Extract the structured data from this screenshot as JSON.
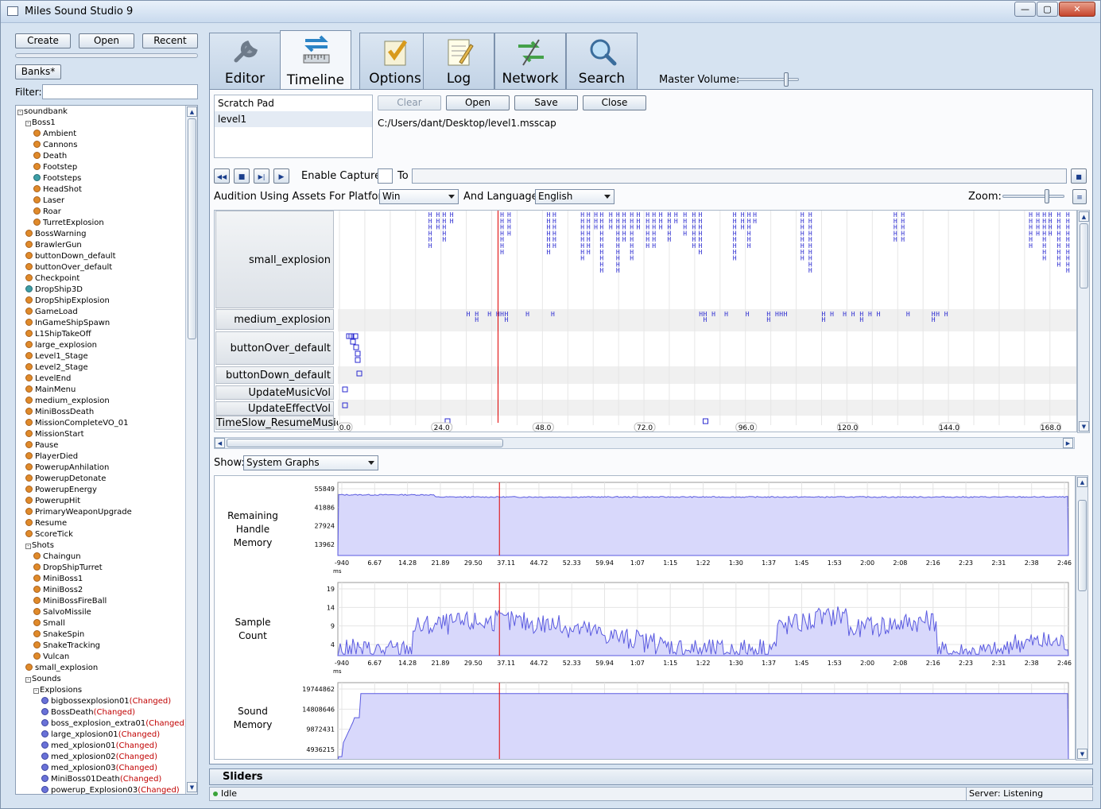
{
  "window": {
    "title": "Miles Sound Studio 9",
    "min": "—",
    "max": "▢",
    "close": "✕"
  },
  "left": {
    "create": "Create",
    "open": "Open",
    "recent": "Recent",
    "banks": "Banks*",
    "filter_label": "Filter:",
    "tree": [
      {
        "d": 0,
        "t": "soundbank",
        "exp": "-"
      },
      {
        "d": 1,
        "t": "Boss1",
        "exp": "-"
      },
      {
        "d": 2,
        "t": "Ambient",
        "icon": "orange"
      },
      {
        "d": 2,
        "t": "Cannons",
        "icon": "orange"
      },
      {
        "d": 2,
        "t": "Death",
        "icon": "orange"
      },
      {
        "d": 2,
        "t": "Footstep",
        "icon": "orange"
      },
      {
        "d": 2,
        "t": "Footsteps",
        "icon": "teal"
      },
      {
        "d": 2,
        "t": "HeadShot",
        "icon": "orange"
      },
      {
        "d": 2,
        "t": "Laser",
        "icon": "orange"
      },
      {
        "d": 2,
        "t": "Roar",
        "icon": "orange"
      },
      {
        "d": 2,
        "t": "TurretExplosion",
        "icon": "orange"
      },
      {
        "d": 1,
        "t": "BossWarning",
        "icon": "orange"
      },
      {
        "d": 1,
        "t": "BrawlerGun",
        "icon": "orange"
      },
      {
        "d": 1,
        "t": "buttonDown_default",
        "icon": "orange"
      },
      {
        "d": 1,
        "t": "buttonOver_default",
        "icon": "orange"
      },
      {
        "d": 1,
        "t": "Checkpoint",
        "icon": "orange"
      },
      {
        "d": 1,
        "t": "DropShip3D",
        "icon": "teal"
      },
      {
        "d": 1,
        "t": "DropShipExplosion",
        "icon": "orange"
      },
      {
        "d": 1,
        "t": "GameLoad",
        "icon": "orange"
      },
      {
        "d": 1,
        "t": "InGameShipSpawn",
        "icon": "orange"
      },
      {
        "d": 1,
        "t": "L1ShipTakeOff",
        "icon": "orange"
      },
      {
        "d": 1,
        "t": "large_explosion",
        "icon": "orange"
      },
      {
        "d": 1,
        "t": "Level1_Stage",
        "icon": "orange"
      },
      {
        "d": 1,
        "t": "Level2_Stage",
        "icon": "orange"
      },
      {
        "d": 1,
        "t": "LevelEnd",
        "icon": "orange"
      },
      {
        "d": 1,
        "t": "MainMenu",
        "icon": "orange"
      },
      {
        "d": 1,
        "t": "medium_explosion",
        "icon": "orange"
      },
      {
        "d": 1,
        "t": "MiniBossDeath",
        "icon": "orange"
      },
      {
        "d": 1,
        "t": "MissionCompleteVO_01",
        "icon": "orange"
      },
      {
        "d": 1,
        "t": "MissionStart",
        "icon": "orange"
      },
      {
        "d": 1,
        "t": "Pause",
        "icon": "orange"
      },
      {
        "d": 1,
        "t": "PlayerDied",
        "icon": "orange"
      },
      {
        "d": 1,
        "t": "PowerupAnhilation",
        "icon": "orange"
      },
      {
        "d": 1,
        "t": "PowerupDetonate",
        "icon": "orange"
      },
      {
        "d": 1,
        "t": "PowerupEnergy",
        "icon": "orange"
      },
      {
        "d": 1,
        "t": "PowerupHit",
        "icon": "orange"
      },
      {
        "d": 1,
        "t": "PrimaryWeaponUpgrade",
        "icon": "orange"
      },
      {
        "d": 1,
        "t": "Resume",
        "icon": "orange"
      },
      {
        "d": 1,
        "t": "ScoreTick",
        "icon": "orange"
      },
      {
        "d": 1,
        "t": "Shots",
        "exp": "-"
      },
      {
        "d": 2,
        "t": "Chaingun",
        "icon": "orange"
      },
      {
        "d": 2,
        "t": "DropShipTurret",
        "icon": "orange"
      },
      {
        "d": 2,
        "t": "MiniBoss1",
        "icon": "orange"
      },
      {
        "d": 2,
        "t": "MiniBoss2",
        "icon": "orange"
      },
      {
        "d": 2,
        "t": "MiniBossFireBall",
        "icon": "orange"
      },
      {
        "d": 2,
        "t": "SalvoMissile",
        "icon": "orange"
      },
      {
        "d": 2,
        "t": "Small",
        "icon": "orange"
      },
      {
        "d": 2,
        "t": "SnakeSpin",
        "icon": "orange"
      },
      {
        "d": 2,
        "t": "SnakeTracking",
        "icon": "orange"
      },
      {
        "d": 2,
        "t": "Vulcan",
        "icon": "orange"
      },
      {
        "d": 1,
        "t": "small_explosion",
        "icon": "orange"
      },
      {
        "d": 1,
        "t": "Sounds",
        "exp": "-"
      },
      {
        "d": 2,
        "t": "Explosions",
        "exp": "-"
      },
      {
        "d": 3,
        "t": "bigbossexplosion01",
        "icon": "blue",
        "chg": "(Changed)"
      },
      {
        "d": 3,
        "t": "BossDeath",
        "icon": "blue",
        "chg": "(Changed)"
      },
      {
        "d": 3,
        "t": "boss_explosion_extra01",
        "icon": "blue",
        "chg": "(Changed)"
      },
      {
        "d": 3,
        "t": "large_xplosion01",
        "icon": "blue",
        "chg": "(Changed)"
      },
      {
        "d": 3,
        "t": "med_xplosion01",
        "icon": "blue",
        "chg": "(Changed)"
      },
      {
        "d": 3,
        "t": "med_xplosion02",
        "icon": "blue",
        "chg": "(Changed)"
      },
      {
        "d": 3,
        "t": "med_xplosion03",
        "icon": "blue",
        "chg": "(Changed)"
      },
      {
        "d": 3,
        "t": "MiniBoss01Death",
        "icon": "blue",
        "chg": "(Changed)"
      },
      {
        "d": 3,
        "t": "powerup_Explosion03",
        "icon": "blue",
        "chg": "(Changed)"
      }
    ]
  },
  "tabs": [
    {
      "label": "Editor",
      "icon": "wrench-icon"
    },
    {
      "label": "Timeline",
      "icon": "timeline-icon"
    },
    {
      "label": "Options",
      "icon": "options-icon"
    },
    {
      "label": "Log",
      "icon": "log-icon"
    },
    {
      "label": "Network",
      "icon": "network-icon"
    },
    {
      "label": "Search",
      "icon": "search-icon"
    }
  ],
  "master_volume": {
    "label": "Master Volume:",
    "value": 0.8
  },
  "timeline_tab": {
    "scratch": [
      "Scratch Pad",
      "level1"
    ],
    "clear": "Clear",
    "open": "Open",
    "save": "Save",
    "close": "Close",
    "path": "C:/Users/dant/Desktop/level1.msscap",
    "enable_capture": "Enable Capture:",
    "to": "To",
    "platform_label": "Audition Using Assets For Platform:",
    "platform": "Win",
    "language_label": "And Language:",
    "language": "English",
    "zoom_label": "Zoom:",
    "zoom": 0.75,
    "show_label": "Show:",
    "show": "System Graphs",
    "tracks": [
      "small_explosion",
      "medium_explosion",
      "buttonOver_default",
      "buttonDown_default",
      "UpdateMusicVol",
      "UpdateEffectVol",
      "TimeSlow_ResumeMusic"
    ],
    "ruler": [
      "0.0",
      "24.0",
      "48.0",
      "72.0",
      "96.0",
      "120.0",
      "144.0",
      "168.0"
    ],
    "playhead": 37.5
  },
  "graphs": [
    {
      "label": [
        "Remaining",
        "Handle",
        "Memory"
      ],
      "ticks": [
        "55849",
        "41886",
        "27924",
        "13962"
      ],
      "max": 55849
    },
    {
      "label": [
        "Sample",
        "Count"
      ],
      "ticks": [
        "19",
        "14",
        "9",
        "4"
      ],
      "max": 19
    },
    {
      "label": [
        "Sound",
        "Memory"
      ],
      "ticks": [
        "19744862",
        "14808646",
        "9872431",
        "4936215"
      ],
      "max": 19744862
    }
  ],
  "graph_x_labels": [
    "-940",
    "6.67",
    "14.28",
    "21.89",
    "29.50",
    "37.11",
    "44.72",
    "52.33",
    "59.94",
    "1:07",
    "1:15",
    "1:22",
    "1:30",
    "1:37",
    "1:45",
    "1:53",
    "2:00",
    "2:08",
    "2:16",
    "2:23",
    "2:31",
    "2:38",
    "2:46"
  ],
  "graph_x_unit": "ms",
  "sliders": "Sliders",
  "status": {
    "left": "Idle",
    "right": "Server: Listening"
  }
}
